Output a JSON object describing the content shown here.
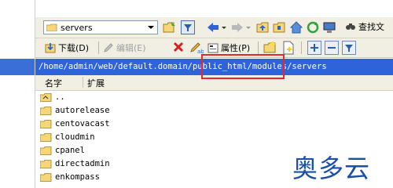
{
  "toolbar_top": {
    "path_combo_value": "servers",
    "search_label": "查找文"
  },
  "toolbar_bottom": {
    "download_label": "下载(D)",
    "edit_label": "编辑(E)",
    "properties_label": "属性(P)"
  },
  "address_bar": {
    "path": "/home/admin/web/default.domain/public_html/modules/servers"
  },
  "columns": {
    "name": "名字",
    "extension": "扩展"
  },
  "files": [
    {
      "name": ".."
    },
    {
      "name": "autorelease"
    },
    {
      "name": "centovacast"
    },
    {
      "name": "cloudmin"
    },
    {
      "name": "cpanel"
    },
    {
      "name": "directadmin"
    },
    {
      "name": "enkompass"
    }
  ],
  "watermark": "奥多云",
  "colors": {
    "address_bg": "#2f63d8",
    "toolbar_bg": "#f1efe3",
    "highlight": "#e8262c",
    "folder": "#f5d77a"
  }
}
